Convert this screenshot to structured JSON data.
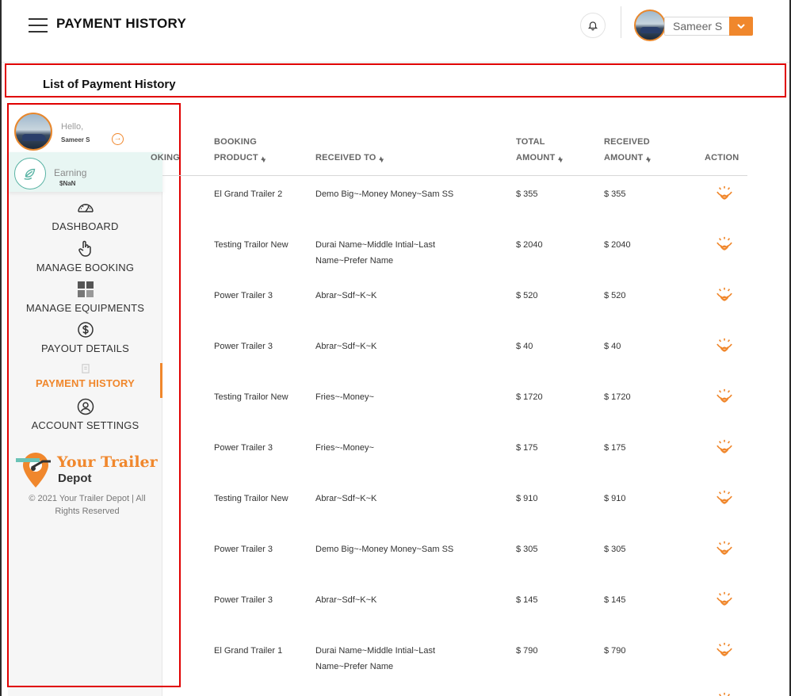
{
  "header": {
    "title": "PAYMENT HISTORY",
    "user_name": "Sameer S"
  },
  "section": {
    "title": "List of Payment History"
  },
  "sidebar": {
    "greeting": "Hello,",
    "profile_name": "Sameer S",
    "earning_label": "Earning",
    "earning_value": "$NaN",
    "nav": [
      {
        "label": "DASHBOARD",
        "icon": "speedometer-icon"
      },
      {
        "label": "MANAGE BOOKING",
        "icon": "hand-pointer-icon"
      },
      {
        "label": "MANAGE EQUIPMENTS",
        "icon": "grid-icon"
      },
      {
        "label": "PAYOUT DETAILS",
        "icon": "dollar-circle-icon"
      },
      {
        "label": "PAYMENT HISTORY",
        "icon": "receipt-icon",
        "active": true
      },
      {
        "label": "ACCOUNT SETTINGS",
        "icon": "user-circle-icon"
      }
    ],
    "logo_line1": "Your Trailer",
    "logo_line2": "Depot",
    "copyright": "© 2021 Your Trailer Depot | All Rights Reserved"
  },
  "table": {
    "columns": [
      {
        "line1": "",
        "line2": "OKING",
        "sortable": false
      },
      {
        "line1": "BOOKING",
        "line2": "PRODUCT",
        "sortable": true
      },
      {
        "line1": "",
        "line2": "RECEIVED TO",
        "sortable": true
      },
      {
        "line1": "TOTAL",
        "line2": "AMOUNT",
        "sortable": true
      },
      {
        "line1": "RECEIVED",
        "line2": "AMOUNT",
        "sortable": true
      },
      {
        "line1": "",
        "line2": "ACTION",
        "sortable": false
      }
    ],
    "rows": [
      {
        "product": "El Grand Trailer 2",
        "received_to": [
          "Demo Big~-Money Money~Sam SS"
        ],
        "total": "$ 355",
        "received": "$ 355"
      },
      {
        "product": "Testing Trailor New",
        "received_to": [
          "Durai Name~Middle Intial~Last",
          "Name~Prefer Name"
        ],
        "total": "$ 2040",
        "received": "$ 2040"
      },
      {
        "product": "Power Trailer 3",
        "received_to": [
          "Abrar~Sdf~K~K"
        ],
        "total": "$ 520",
        "received": "$ 520"
      },
      {
        "product": "Power Trailer 3",
        "received_to": [
          "Abrar~Sdf~K~K"
        ],
        "total": "$ 40",
        "received": "$ 40"
      },
      {
        "product": "Testing Trailor New",
        "received_to": [
          "Fries~-Money~"
        ],
        "total": "$ 1720",
        "received": "$ 1720"
      },
      {
        "product": "Power Trailer 3",
        "received_to": [
          "Fries~-Money~"
        ],
        "total": "$ 175",
        "received": "$ 175"
      },
      {
        "product": "Testing Trailor New",
        "received_to": [
          "Abrar~Sdf~K~K"
        ],
        "total": "$ 910",
        "received": "$ 910"
      },
      {
        "product": "Power Trailer 3",
        "received_to": [
          "Demo Big~-Money Money~Sam SS"
        ],
        "total": "$ 305",
        "received": "$ 305"
      },
      {
        "product": "Power Trailer 3",
        "received_to": [
          "Abrar~Sdf~K~K"
        ],
        "total": "$ 145",
        "received": "$ 145"
      },
      {
        "product": "El Grand Trailer 1",
        "received_to": [
          "Durai Name~Middle Intial~Last",
          "Name~Prefer Name"
        ],
        "total": "$ 790",
        "received": "$ 790"
      }
    ],
    "action_icon": "eye-view-icon"
  },
  "colors": {
    "accent": "#f0872c",
    "highlight_outline": "#e00000",
    "earning_bg": "#e8f6f3"
  }
}
